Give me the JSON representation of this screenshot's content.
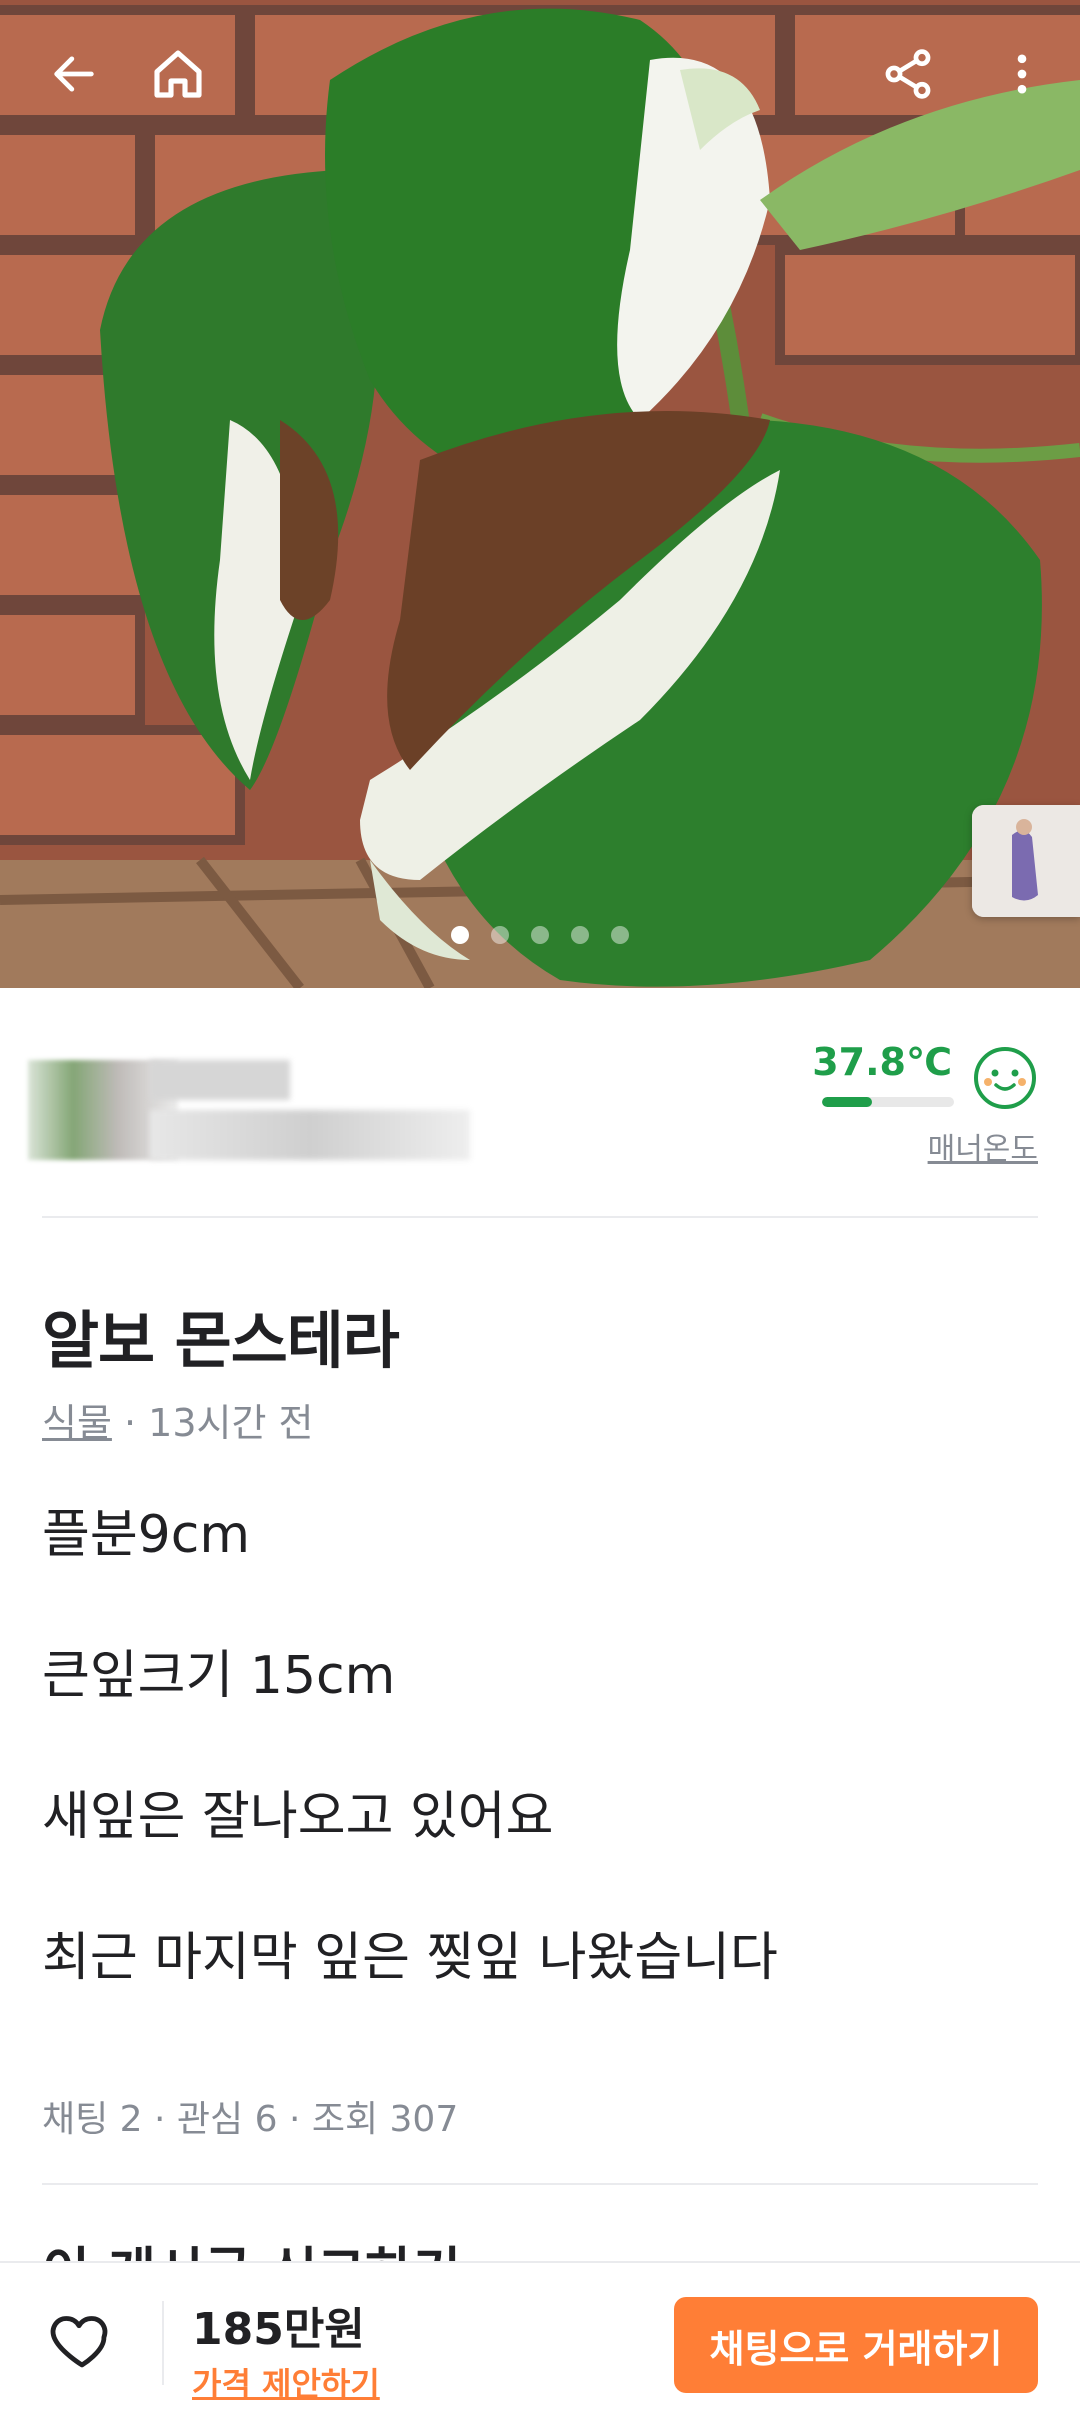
{
  "topbar": {
    "back_icon": "arrow-left-icon",
    "home_icon": "home-icon",
    "share_icon": "share-icon",
    "more_icon": "more-vertical-icon"
  },
  "gallery": {
    "image_count": 5,
    "active_index": 0
  },
  "seller": {
    "temperature": "37.8℃",
    "temperature_level": 0.378,
    "temperature_label": "매너온도",
    "face_icon": "smile-face-icon"
  },
  "post": {
    "title": "알보 몬스테라",
    "category": "식물",
    "time": " · 13시간 전",
    "description": [
      "플분9cm",
      "큰잎크기 15cm",
      "새잎은 잘나오고 있어요",
      "최근 마지막 잎은 찢잎 나왔습니다"
    ],
    "stats": "채팅 2 · 관심 6 · 조회 307",
    "cutoff_text": "이 게시글 신고하기"
  },
  "bottom": {
    "heart_icon": "heart-outline-icon",
    "price": "185만원",
    "offer_label": "가격 제안하기",
    "chat_button": "채팅으로 거래하기"
  },
  "colors": {
    "accent": "#ff7e36",
    "temperature": "#1f9e4a",
    "muted": "#868b94"
  }
}
